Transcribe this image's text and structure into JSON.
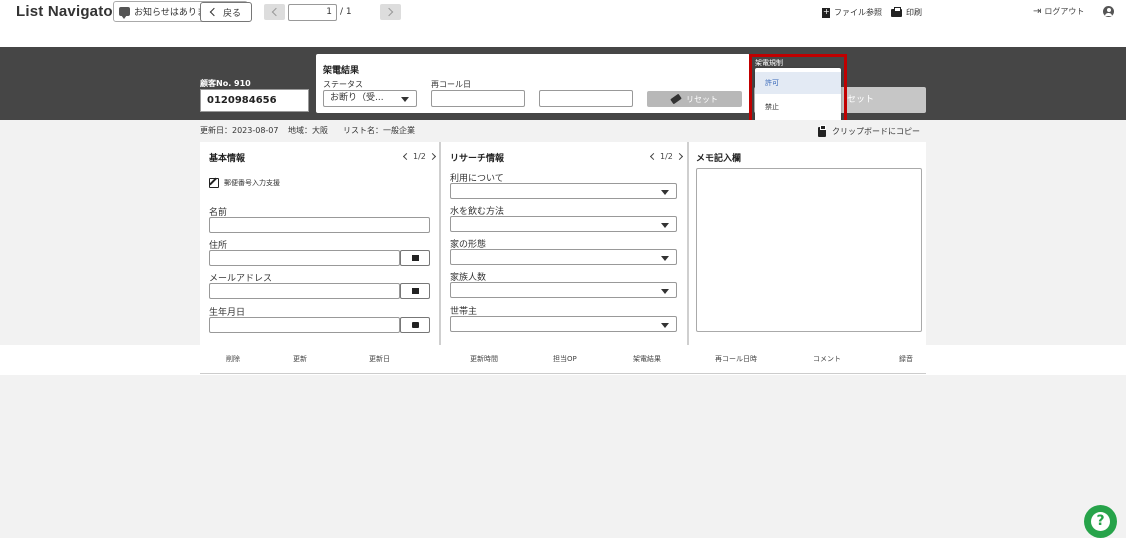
{
  "header": {
    "brand": "List Navigator.",
    "notice": "お知らせはありません",
    "logout": "ログアウト"
  },
  "nav": {
    "back": "戻る",
    "page_current": "1",
    "page_total": "/ 1",
    "file_ref": "ファイル参照",
    "print": "印刷"
  },
  "customer": {
    "label": "顧客No. 910",
    "phone": "0120984656"
  },
  "call_result": {
    "title": "架電結果",
    "status_label": "ステータス",
    "status_value": "お断り（受...",
    "recall_label": "再コール日",
    "reset": "リセット"
  },
  "dial": {
    "button_label": "セット",
    "rule_label": "架電規制",
    "options": [
      "許可",
      "禁止"
    ]
  },
  "info": {
    "updated": "更新日：2023-08-07",
    "region": "地域：大阪",
    "list_name": "リスト名：一般企業",
    "clipboard": "クリップボードにコピー"
  },
  "basic": {
    "title": "基本情報",
    "pager": "1/2",
    "zip_assist": "郵便番号入力支援",
    "fields": [
      "名前",
      "住所",
      "メールアドレス",
      "生年月日"
    ]
  },
  "research": {
    "title": "リサーチ情報",
    "pager": "1/2",
    "fields": [
      "利用について",
      "水を飲む方法",
      "家の形態",
      "家族人数",
      "世帯主"
    ]
  },
  "memo": {
    "title": "メモ記入欄"
  },
  "table": {
    "headers": [
      "削除",
      "更新",
      "更新日",
      "更新時間",
      "担当OP",
      "架電結果",
      "再コール日時",
      "コメント",
      "録音"
    ]
  },
  "colors": {
    "band": "#464646",
    "help": "#27a34a",
    "highlight": "#c00000",
    "selected_option": "#3566b8"
  }
}
